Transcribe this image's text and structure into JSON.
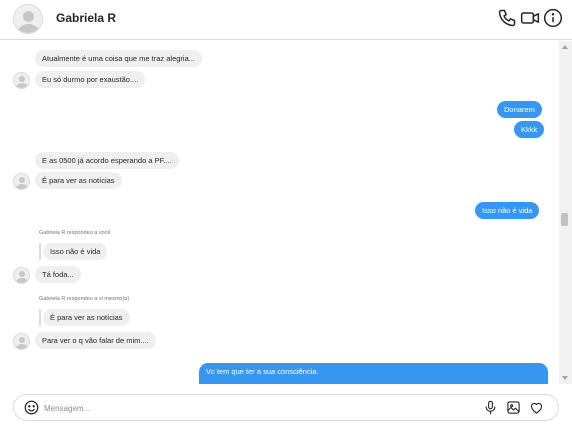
{
  "header": {
    "contact_name": "Gabriela R",
    "icons": [
      "phone-icon",
      "video-icon",
      "info-icon"
    ]
  },
  "messages": [
    {
      "direction": "incoming",
      "text": "Atualmente é uma coisa que me traz alegria..."
    },
    {
      "direction": "incoming",
      "text": "Eu só durmo por exaustão...."
    },
    {
      "direction": "outgoing",
      "text": "Donarem"
    },
    {
      "direction": "outgoing",
      "text": "Kkkk"
    },
    {
      "direction": "incoming",
      "text": "E as 0500 já acordo esperando a PF...."
    },
    {
      "direction": "incoming",
      "text": "É para ver as notícias"
    },
    {
      "direction": "outgoing",
      "text": "Isso não é vida"
    },
    {
      "direction": "incoming",
      "reply_meta": "Gabriela R respondeu a você",
      "quoted": "Isso não é vida",
      "text": "Tá foda..."
    },
    {
      "direction": "incoming",
      "reply_meta": "Gabriela R respondeu a si mesmo(a)",
      "quoted": "É para ver as notícias",
      "text": "Para ver o q vão falar de mim...."
    },
    {
      "direction": "outgoing",
      "text": "Vc tem que ter a sua consciência."
    }
  ],
  "composer": {
    "placeholder": "Mensagem...",
    "icons": [
      "emoji-icon",
      "microphone-icon",
      "image-icon",
      "heart-icon"
    ]
  },
  "colors": {
    "outgoing_bubble": "#3797f0",
    "incoming_bubble": "#efefef",
    "border": "#dbdbdb"
  }
}
